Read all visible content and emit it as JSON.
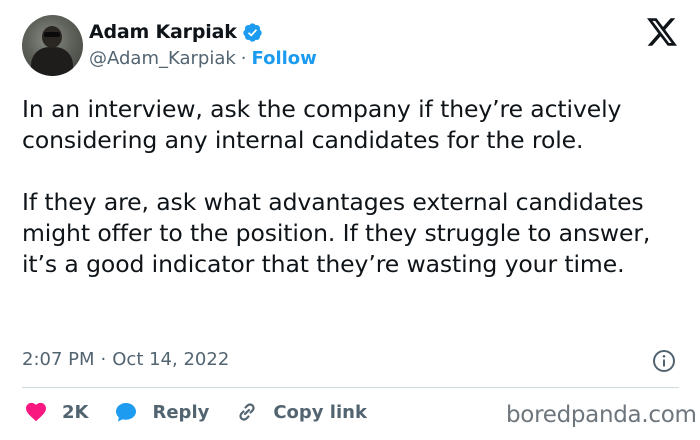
{
  "author": {
    "display_name": "Adam Karpiak",
    "handle": "@Adam_Karpiak",
    "separator": "·",
    "follow_label": "Follow"
  },
  "tweet": {
    "paragraphs": [
      "In an interview, ask the company if they’re actively considering any internal candidates for the role.",
      "If they are, ask what advantages external candidates might offer to the position. If they struggle to answer, it’s a good indicator that they’re wasting your time."
    ],
    "time": "2:07 PM",
    "date_separator": "·",
    "date": "Oct 14, 2022"
  },
  "actions": {
    "likes_count": "2K",
    "reply_label": "Reply",
    "copy_link_label": "Copy link"
  },
  "watermark": "boredpanda.com",
  "icons": {
    "verified": "verified-badge-icon",
    "brand": "x-logo-icon",
    "info": "info-icon",
    "like": "heart-icon",
    "reply": "speech-bubble-icon",
    "copy_link": "link-icon"
  },
  "colors": {
    "accent": "#1d9bf0",
    "like": "#f91880",
    "text": "#0f1419",
    "secondary": "#536471",
    "divider": "#cfd9de"
  }
}
